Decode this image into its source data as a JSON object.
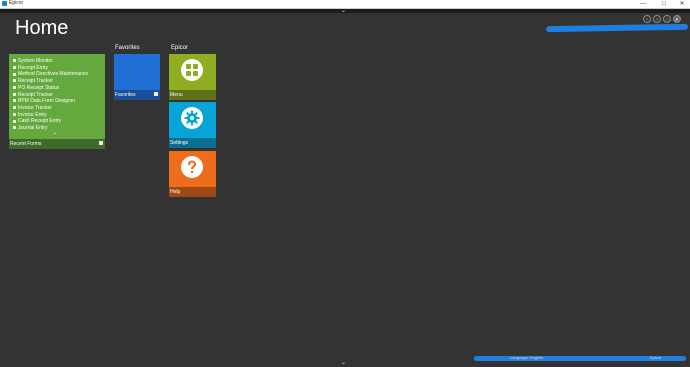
{
  "window": {
    "title": "Epicor",
    "minimize": "—",
    "maximize": "□",
    "close": "✕"
  },
  "header": {
    "title": "Home",
    "top_chevron": "⌄",
    "nav": {
      "back": "‹",
      "forward": "›",
      "home": "⌂",
      "search": "⌕"
    }
  },
  "groups": {
    "favorites_label": "Favorites",
    "epicor_label": "Epicor"
  },
  "recent_forms": {
    "items": [
      "System Monitor",
      "Receipt Entry",
      "Method Directives Maintenance",
      "Receipt Tracker",
      "PO Receipt Status",
      "Receipt Tracker",
      "BPM Data Form Designer",
      "Invoice Tracker",
      "Invoice Entry",
      "Cash Receipt Entry",
      "Journal Entry"
    ],
    "more": "⌄",
    "label": "Recent Forms"
  },
  "tiles": {
    "favorites": "Favorites",
    "menu": "Menu",
    "settings": "Settings",
    "help": "Help"
  },
  "status": {
    "language": "Language: English",
    "user": "Epicor"
  },
  "colors": {
    "recent": "#64a83e",
    "favorites": "#1f6fd4",
    "menu": "#8fad21",
    "settings": "#08a4d8",
    "help": "#ee6d1d",
    "background": "#333333"
  },
  "icons": {
    "menu": "grid-icon",
    "settings": "gear-icon",
    "help": "question-icon"
  }
}
